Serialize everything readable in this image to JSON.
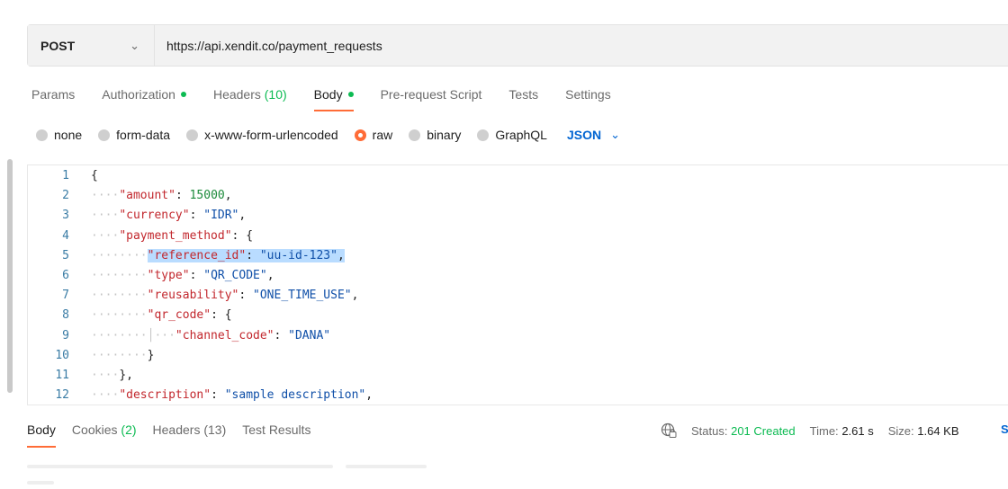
{
  "request": {
    "method": "POST",
    "url": "https://api.xendit.co/payment_requests"
  },
  "request_tabs": [
    {
      "label": "Params"
    },
    {
      "label": "Authorization",
      "dot": true
    },
    {
      "label": "Headers",
      "count": "(10)"
    },
    {
      "label": "Body",
      "dot": true,
      "active": true
    },
    {
      "label": "Pre-request Script"
    },
    {
      "label": "Tests"
    },
    {
      "label": "Settings"
    }
  ],
  "body_types": [
    {
      "label": "none"
    },
    {
      "label": "form-data"
    },
    {
      "label": "x-www-form-urlencoded"
    },
    {
      "label": "raw",
      "selected": true
    },
    {
      "label": "binary"
    },
    {
      "label": "GraphQL"
    }
  ],
  "format_selector": "JSON",
  "editor_lines": [
    {
      "n": "1",
      "indent": "",
      "parts": [
        [
          "p",
          "{"
        ]
      ]
    },
    {
      "n": "2",
      "indent": "····",
      "parts": [
        [
          "k",
          "\"amount\""
        ],
        [
          "p",
          ": "
        ],
        [
          "n",
          "15000"
        ],
        [
          "p",
          ","
        ]
      ]
    },
    {
      "n": "3",
      "indent": "····",
      "parts": [
        [
          "k",
          "\"currency\""
        ],
        [
          "p",
          ": "
        ],
        [
          "s",
          "\"IDR\""
        ],
        [
          "p",
          ","
        ]
      ]
    },
    {
      "n": "4",
      "indent": "····",
      "parts": [
        [
          "k",
          "\"payment_method\""
        ],
        [
          "p",
          ": {"
        ]
      ]
    },
    {
      "n": "5",
      "indent": "········",
      "highlight": true,
      "parts": [
        [
          "k",
          "\"reference_id\""
        ],
        [
          "p",
          ": "
        ],
        [
          "s",
          "\"uu-id-123\""
        ],
        [
          "p",
          ","
        ]
      ]
    },
    {
      "n": "6",
      "indent": "········",
      "parts": [
        [
          "k",
          "\"type\""
        ],
        [
          "p",
          ": "
        ],
        [
          "s",
          "\"QR_CODE\""
        ],
        [
          "p",
          ","
        ]
      ]
    },
    {
      "n": "7",
      "indent": "········",
      "parts": [
        [
          "k",
          "\"reusability\""
        ],
        [
          "p",
          ": "
        ],
        [
          "s",
          "\"ONE_TIME_USE\""
        ],
        [
          "p",
          ","
        ]
      ]
    },
    {
      "n": "8",
      "indent": "········",
      "parts": [
        [
          "k",
          "\"qr_code\""
        ],
        [
          "p",
          ": {"
        ]
      ]
    },
    {
      "n": "9",
      "indent": "········│···",
      "parts": [
        [
          "k",
          "\"channel_code\""
        ],
        [
          "p",
          ": "
        ],
        [
          "s",
          "\"DANA\""
        ]
      ]
    },
    {
      "n": "10",
      "indent": "········",
      "parts": [
        [
          "p",
          "}"
        ]
      ]
    },
    {
      "n": "11",
      "indent": "····",
      "parts": [
        [
          "p",
          "},"
        ]
      ]
    },
    {
      "n": "12",
      "indent": "····",
      "parts": [
        [
          "k",
          "\"description\""
        ],
        [
          "p",
          ": "
        ],
        [
          "s",
          "\"sample description\""
        ],
        [
          "p",
          ","
        ]
      ]
    }
  ],
  "response_tabs": [
    {
      "label": "Body",
      "active": true
    },
    {
      "label": "Cookies",
      "count": "(2)"
    },
    {
      "label": "Headers",
      "count": "(13)"
    },
    {
      "label": "Test Results"
    }
  ],
  "response_status": {
    "status_label": "Status:",
    "status_value": "201 Created",
    "time_label": "Time:",
    "time_value": "2.61 s",
    "size_label": "Size:",
    "size_value": "1.64 KB",
    "save_glyph": "S"
  },
  "icons": {
    "method_dropdown": "chevron-down-icon",
    "format_dropdown": "chevron-down-icon",
    "network": "globe-network-icon"
  },
  "colors": {
    "accent": "#ff6c37",
    "green": "#0cbb52",
    "link_blue": "#0265d2",
    "json_key": "#c2272d",
    "json_string": "#0f4fa8",
    "json_number": "#1b8a3a"
  }
}
